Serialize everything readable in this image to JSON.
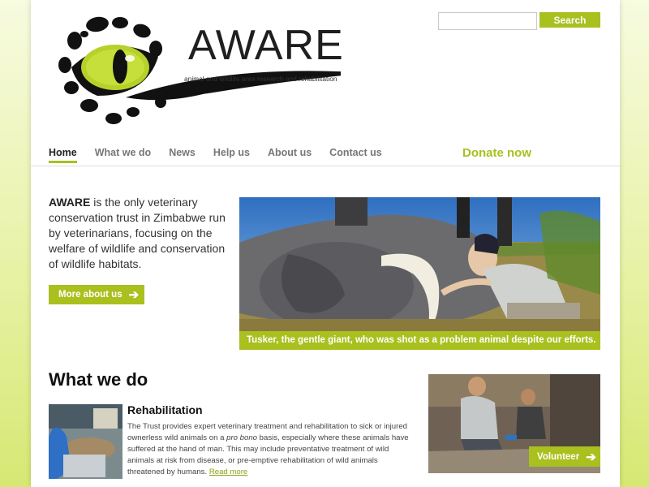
{
  "header": {
    "logo_title": "AWARE",
    "logo_tagline": "animal and wildlife area research and rehabilitation",
    "search_placeholder": "",
    "search_label": "Search"
  },
  "nav": {
    "items": [
      {
        "label": "Home",
        "active": true
      },
      {
        "label": "What we do"
      },
      {
        "label": "News"
      },
      {
        "label": "Help us"
      },
      {
        "label": "About us"
      },
      {
        "label": "Contact us"
      }
    ],
    "donate_label": "Donate now"
  },
  "intro": {
    "strong": "AWARE",
    "text": " is the only veterinary conservation trust in Zimbabwe run by veterinarians, focusing on the welfare of wildlife and conservation of wildlife habitats.",
    "button_label": "More about us"
  },
  "hero": {
    "caption": "Tusker, the gentle giant, who was shot as a problem animal despite our efforts."
  },
  "what_we_do": {
    "title": "What we do",
    "item_title": "Rehabilitation",
    "item_text_1": "The Trust provides expert veterinary treatment and rehabilitation to sick or injured ownerless wild animals on a ",
    "item_text_em": "pro bono",
    "item_text_2": " basis, especially where these animals have suffered at the hand of man. This may include preventative treatment of wild animals at risk from disease, or pre-emptive rehabilitation of wild animals threatened by humans. ",
    "read_more": "Read more",
    "volunteer_label": "Volunteer"
  },
  "colors": {
    "accent": "#a9c01f",
    "text": "#333333"
  }
}
